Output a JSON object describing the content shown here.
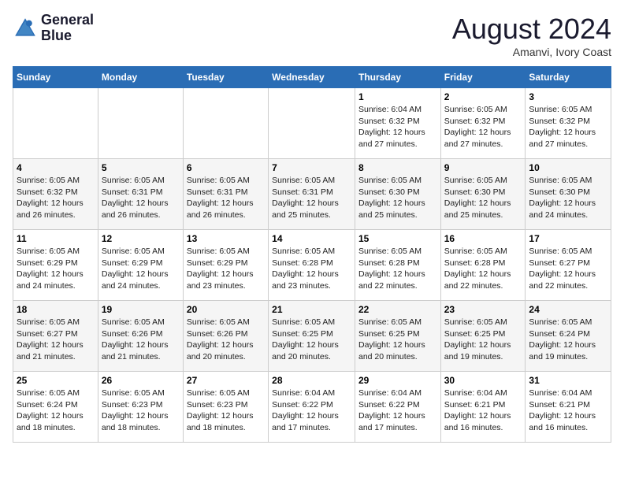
{
  "logo": {
    "line1": "General",
    "line2": "Blue"
  },
  "title": "August 2024",
  "subtitle": "Amanvi, Ivory Coast",
  "days_of_week": [
    "Sunday",
    "Monday",
    "Tuesday",
    "Wednesday",
    "Thursday",
    "Friday",
    "Saturday"
  ],
  "weeks": [
    [
      {
        "day": "",
        "info": ""
      },
      {
        "day": "",
        "info": ""
      },
      {
        "day": "",
        "info": ""
      },
      {
        "day": "",
        "info": ""
      },
      {
        "day": "1",
        "info": "Sunrise: 6:04 AM\nSunset: 6:32 PM\nDaylight: 12 hours and 27 minutes."
      },
      {
        "day": "2",
        "info": "Sunrise: 6:05 AM\nSunset: 6:32 PM\nDaylight: 12 hours and 27 minutes."
      },
      {
        "day": "3",
        "info": "Sunrise: 6:05 AM\nSunset: 6:32 PM\nDaylight: 12 hours and 27 minutes."
      }
    ],
    [
      {
        "day": "4",
        "info": "Sunrise: 6:05 AM\nSunset: 6:32 PM\nDaylight: 12 hours and 26 minutes."
      },
      {
        "day": "5",
        "info": "Sunrise: 6:05 AM\nSunset: 6:31 PM\nDaylight: 12 hours and 26 minutes."
      },
      {
        "day": "6",
        "info": "Sunrise: 6:05 AM\nSunset: 6:31 PM\nDaylight: 12 hours and 26 minutes."
      },
      {
        "day": "7",
        "info": "Sunrise: 6:05 AM\nSunset: 6:31 PM\nDaylight: 12 hours and 25 minutes."
      },
      {
        "day": "8",
        "info": "Sunrise: 6:05 AM\nSunset: 6:30 PM\nDaylight: 12 hours and 25 minutes."
      },
      {
        "day": "9",
        "info": "Sunrise: 6:05 AM\nSunset: 6:30 PM\nDaylight: 12 hours and 25 minutes."
      },
      {
        "day": "10",
        "info": "Sunrise: 6:05 AM\nSunset: 6:30 PM\nDaylight: 12 hours and 24 minutes."
      }
    ],
    [
      {
        "day": "11",
        "info": "Sunrise: 6:05 AM\nSunset: 6:29 PM\nDaylight: 12 hours and 24 minutes."
      },
      {
        "day": "12",
        "info": "Sunrise: 6:05 AM\nSunset: 6:29 PM\nDaylight: 12 hours and 24 minutes."
      },
      {
        "day": "13",
        "info": "Sunrise: 6:05 AM\nSunset: 6:29 PM\nDaylight: 12 hours and 23 minutes."
      },
      {
        "day": "14",
        "info": "Sunrise: 6:05 AM\nSunset: 6:28 PM\nDaylight: 12 hours and 23 minutes."
      },
      {
        "day": "15",
        "info": "Sunrise: 6:05 AM\nSunset: 6:28 PM\nDaylight: 12 hours and 22 minutes."
      },
      {
        "day": "16",
        "info": "Sunrise: 6:05 AM\nSunset: 6:28 PM\nDaylight: 12 hours and 22 minutes."
      },
      {
        "day": "17",
        "info": "Sunrise: 6:05 AM\nSunset: 6:27 PM\nDaylight: 12 hours and 22 minutes."
      }
    ],
    [
      {
        "day": "18",
        "info": "Sunrise: 6:05 AM\nSunset: 6:27 PM\nDaylight: 12 hours and 21 minutes."
      },
      {
        "day": "19",
        "info": "Sunrise: 6:05 AM\nSunset: 6:26 PM\nDaylight: 12 hours and 21 minutes."
      },
      {
        "day": "20",
        "info": "Sunrise: 6:05 AM\nSunset: 6:26 PM\nDaylight: 12 hours and 20 minutes."
      },
      {
        "day": "21",
        "info": "Sunrise: 6:05 AM\nSunset: 6:25 PM\nDaylight: 12 hours and 20 minutes."
      },
      {
        "day": "22",
        "info": "Sunrise: 6:05 AM\nSunset: 6:25 PM\nDaylight: 12 hours and 20 minutes."
      },
      {
        "day": "23",
        "info": "Sunrise: 6:05 AM\nSunset: 6:25 PM\nDaylight: 12 hours and 19 minutes."
      },
      {
        "day": "24",
        "info": "Sunrise: 6:05 AM\nSunset: 6:24 PM\nDaylight: 12 hours and 19 minutes."
      }
    ],
    [
      {
        "day": "25",
        "info": "Sunrise: 6:05 AM\nSunset: 6:24 PM\nDaylight: 12 hours and 18 minutes."
      },
      {
        "day": "26",
        "info": "Sunrise: 6:05 AM\nSunset: 6:23 PM\nDaylight: 12 hours and 18 minutes."
      },
      {
        "day": "27",
        "info": "Sunrise: 6:05 AM\nSunset: 6:23 PM\nDaylight: 12 hours and 18 minutes."
      },
      {
        "day": "28",
        "info": "Sunrise: 6:04 AM\nSunset: 6:22 PM\nDaylight: 12 hours and 17 minutes."
      },
      {
        "day": "29",
        "info": "Sunrise: 6:04 AM\nSunset: 6:22 PM\nDaylight: 12 hours and 17 minutes."
      },
      {
        "day": "30",
        "info": "Sunrise: 6:04 AM\nSunset: 6:21 PM\nDaylight: 12 hours and 16 minutes."
      },
      {
        "day": "31",
        "info": "Sunrise: 6:04 AM\nSunset: 6:21 PM\nDaylight: 12 hours and 16 minutes."
      }
    ]
  ]
}
